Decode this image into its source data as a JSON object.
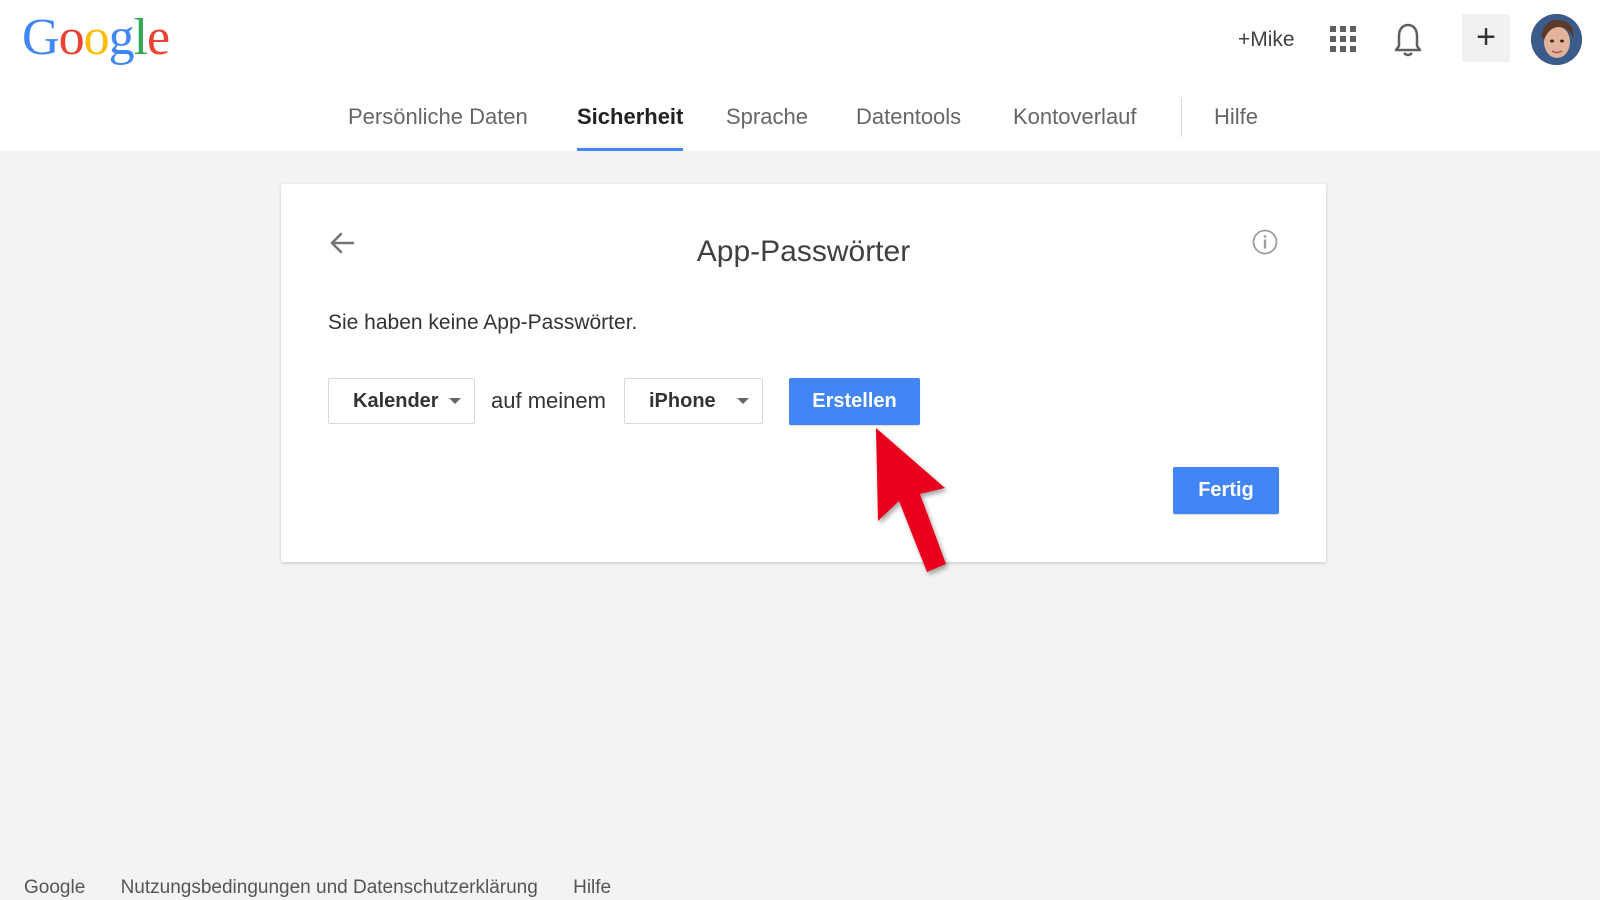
{
  "header": {
    "logo_letters": [
      "G",
      "o",
      "o",
      "g",
      "l",
      "e"
    ],
    "user_link": "+Mike"
  },
  "nav": {
    "tabs": [
      {
        "label": "Persönliche Daten"
      },
      {
        "label": "Sicherheit",
        "active": true
      },
      {
        "label": "Sprache"
      },
      {
        "label": "Datentools"
      },
      {
        "label": "Kontoverlauf"
      },
      {
        "label": "Hilfe"
      }
    ]
  },
  "card": {
    "title": "App-Passwörter",
    "empty_message": "Sie haben keine App-Passwörter.",
    "app_select": {
      "selected": "Kalender"
    },
    "connector_text": "auf meinem",
    "device_select": {
      "selected": "iPhone"
    },
    "create_button": "Erstellen",
    "done_button": "Fertig"
  },
  "footer": {
    "links": [
      "Google",
      "Nutzungsbedingungen und Datenschutzerklärung",
      "Hilfe"
    ]
  },
  "colors": {
    "accent_blue": "#4285f4",
    "annotation_red": "#e8001c",
    "page_background": "#f3f3f3"
  },
  "icons": [
    "apps-grid-icon",
    "bell-icon",
    "plus-icon",
    "back-arrow-icon",
    "info-icon",
    "dropdown-caret-icon"
  ]
}
